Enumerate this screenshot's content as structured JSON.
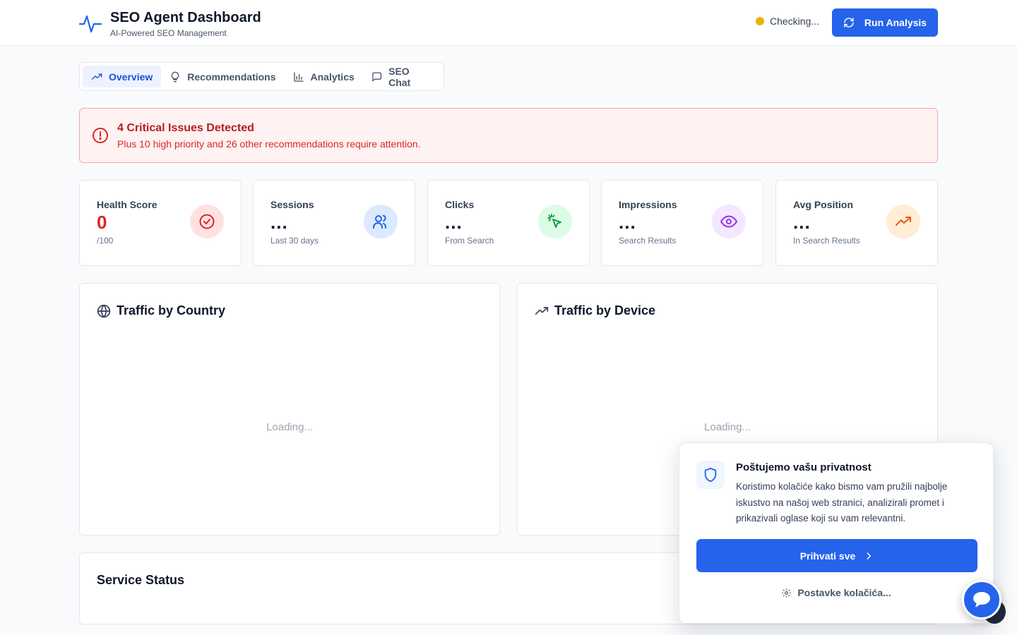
{
  "header": {
    "title": "SEO Agent Dashboard",
    "subtitle": "AI-Powered SEO Management",
    "status_text": "Checking...",
    "run_button": "Run Analysis"
  },
  "tabs": [
    {
      "label": "Overview",
      "icon": "trending-up-icon"
    },
    {
      "label": "Recommendations",
      "icon": "lightbulb-icon"
    },
    {
      "label": "Analytics",
      "icon": "bar-chart-icon"
    },
    {
      "label": "SEO Chat",
      "icon": "message-square-icon"
    }
  ],
  "alert": {
    "title": "4 Critical Issues Detected",
    "text": "Plus 10 high priority and 26 other recommendations require attention."
  },
  "cards": [
    {
      "label": "Health Score",
      "value": "0",
      "sub": "/100",
      "icon": "check-circle-icon"
    },
    {
      "label": "Sessions",
      "value": "...",
      "sub": "Last 30 days",
      "icon": "users-icon"
    },
    {
      "label": "Clicks",
      "value": "...",
      "sub": "From Search",
      "icon": "cursor-click-icon"
    },
    {
      "label": "Impressions",
      "value": "...",
      "sub": "Search Results",
      "icon": "eye-icon"
    },
    {
      "label": "Avg Position",
      "value": "...",
      "sub": "In Search Results",
      "icon": "trending-up-icon"
    }
  ],
  "panels": {
    "country": {
      "title": "Traffic by Country",
      "loading": "Loading..."
    },
    "device": {
      "title": "Traffic by Device",
      "loading": "Loading..."
    },
    "service": {
      "title": "Service Status"
    }
  },
  "cookie": {
    "title": "Poštujemo vašu privatnost",
    "text": "Koristimo kolačiće kako bismo vam pružili najbolje iskustvo na našoj web stranici, analizirali promet i prikazivali oglase koji su vam relevantni.",
    "accept": "Prihvati sve",
    "settings": "Postavke kolačića..."
  },
  "colors": {
    "primary": "#2563eb",
    "status_dot": "#eab308",
    "danger": "#dc2626"
  }
}
